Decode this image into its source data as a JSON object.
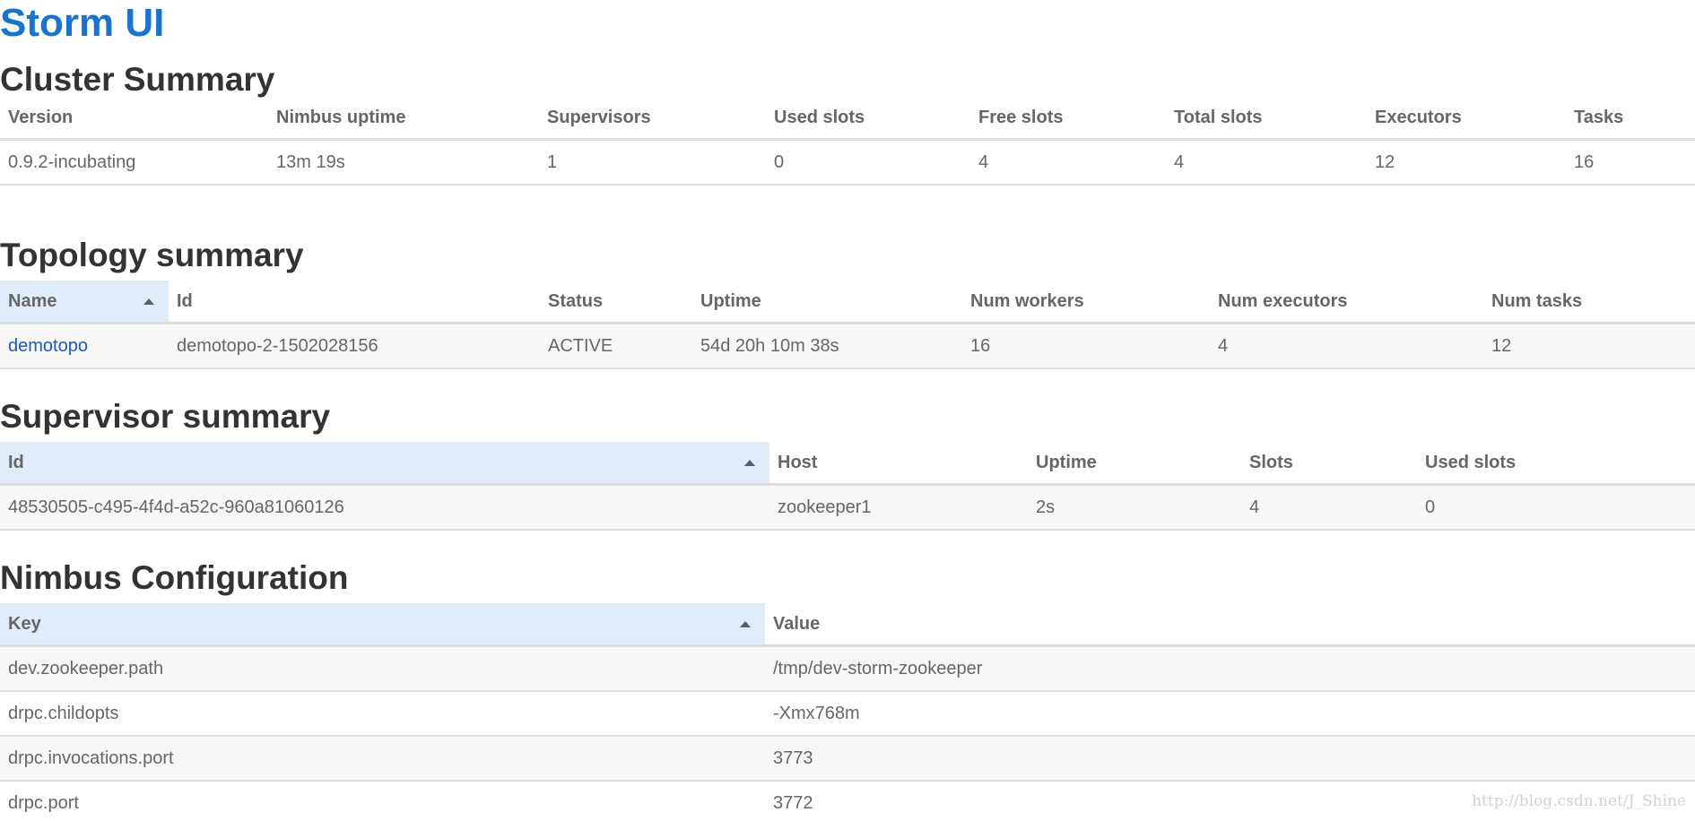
{
  "app_title": "Storm UI",
  "cluster_summary": {
    "title": "Cluster Summary",
    "headers": [
      "Version",
      "Nimbus uptime",
      "Supervisors",
      "Used slots",
      "Free slots",
      "Total slots",
      "Executors",
      "Tasks"
    ],
    "rows": [
      [
        "0.9.2-incubating",
        "13m 19s",
        "1",
        "0",
        "4",
        "4",
        "12",
        "16"
      ]
    ]
  },
  "topology_summary": {
    "title": "Topology summary",
    "headers": [
      "Name",
      "Id",
      "Status",
      "Uptime",
      "Num workers",
      "Num executors",
      "Num tasks"
    ],
    "rows": [
      [
        "demotopo",
        "demotopo-2-1502028156",
        "ACTIVE",
        "54d 20h 10m 38s",
        "16",
        "4",
        "12"
      ]
    ]
  },
  "supervisor_summary": {
    "title": "Supervisor summary",
    "headers": [
      "Id",
      "Host",
      "Uptime",
      "Slots",
      "Used slots"
    ],
    "rows": [
      [
        "48530505-c495-4f4d-a52c-960a81060126",
        "zookeeper1",
        "2s",
        "4",
        "0"
      ]
    ]
  },
  "nimbus_configuration": {
    "title": "Nimbus Configuration",
    "headers": [
      "Key",
      "Value"
    ],
    "rows": [
      [
        "dev.zookeeper.path",
        "/tmp/dev-storm-zookeeper"
      ],
      [
        "drpc.childopts",
        "-Xmx768m"
      ],
      [
        "drpc.invocations.port",
        "3773"
      ],
      [
        "drpc.port",
        "3772"
      ]
    ]
  },
  "watermark": "http://blog.csdn.net/J_Shine",
  "colors": {
    "title_blue": "#1874cd",
    "link_blue": "#1a5bb5",
    "sorted_header_bg": "#e0ecf7",
    "row_stripe": "#f7f7f7"
  }
}
